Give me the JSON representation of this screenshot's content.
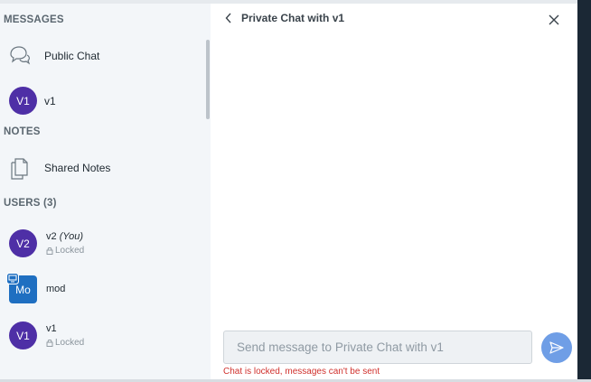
{
  "sidebar": {
    "messages_title": "MESSAGES",
    "chats": [
      {
        "label": "Public Chat",
        "icon": "chat-bubbles-icon"
      },
      {
        "label": "v1",
        "avatar": "V1"
      }
    ],
    "notes_title": "NOTES",
    "notes": [
      {
        "label": "Shared Notes",
        "icon": "notes-icon"
      }
    ],
    "users_title": "USERS (3)",
    "users": [
      {
        "avatar": "V2",
        "name": "v2",
        "you": "(You)",
        "status": "Locked"
      },
      {
        "avatar": "Mo",
        "name": "mod",
        "status": ""
      },
      {
        "avatar": "V1",
        "name": "v1",
        "status": "Locked"
      }
    ]
  },
  "chat": {
    "title": "Private Chat with v1",
    "input_placeholder": "Send message to Private Chat with v1",
    "error": "Chat is locked, messages can't be sent"
  },
  "colors": {
    "avatar_purple": "#4e2fa6",
    "avatar_blue": "#1f6fc1",
    "send_button": "#6f9ee6",
    "error": "#d0312d"
  }
}
